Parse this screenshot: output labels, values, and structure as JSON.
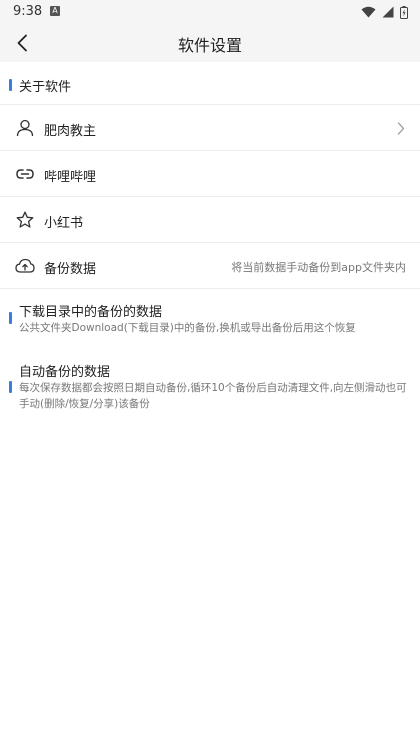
{
  "status_bar": {
    "time": "9:38",
    "notification_icon": "A",
    "icons": [
      "wifi-icon",
      "signal-icon",
      "battery-icon"
    ]
  },
  "app_bar": {
    "title": "软件设置",
    "back_icon": "chevron-left-icon"
  },
  "about_section": {
    "title": "关于软件"
  },
  "menu_items": [
    {
      "label": "肥肉教主",
      "icon": "user-icon",
      "has_chevron": true,
      "hint": ""
    },
    {
      "label": "哔哩哔哩",
      "icon": "link-icon",
      "has_chevron": false,
      "hint": ""
    },
    {
      "label": "小红书",
      "icon": "star-icon",
      "has_chevron": false,
      "hint": ""
    },
    {
      "label": "备份数据",
      "icon": "cloud-upload-icon",
      "has_chevron": false,
      "hint": "将当前数据手动备份到app文件夹内"
    }
  ],
  "info_blocks": [
    {
      "title": "下载目录中的备份的数据",
      "description": "公共文件夹Download(下载目录)中的备份,换机或导出备份后用这个恢复"
    },
    {
      "title": "自动备份的数据",
      "description": "每次保存数据都会按照日期自动备份,循环10个备份后自动清理文件,向左侧滑动也可手动(删除/恢复/分享)该备份"
    }
  ],
  "colors": {
    "accent": "#3b7ddd",
    "header_bg": "#f5f5f5",
    "divider": "#ececec",
    "secondary_text": "#777777"
  }
}
